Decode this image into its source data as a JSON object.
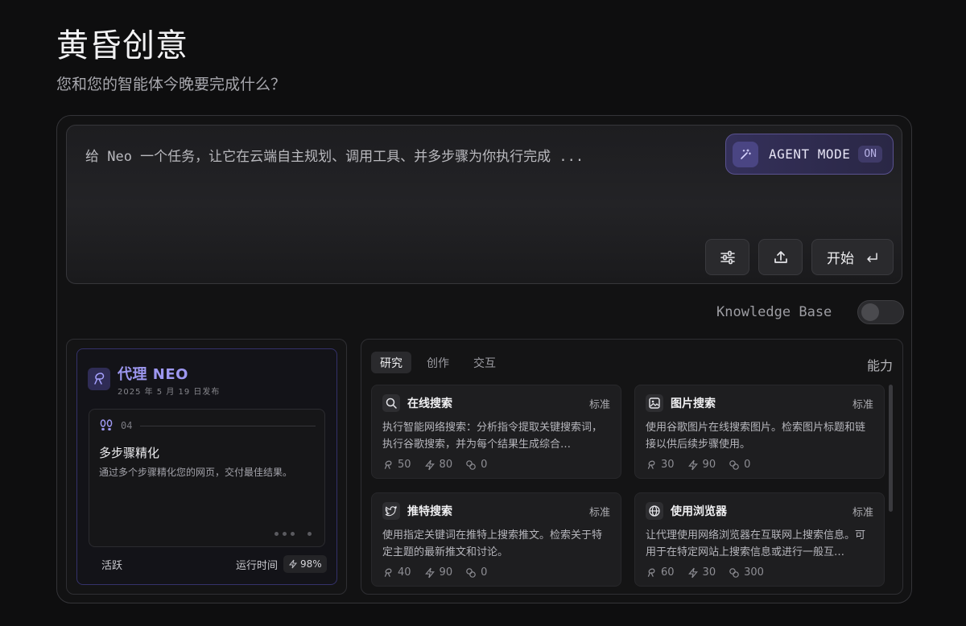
{
  "header": {
    "title": "黄昏创意",
    "subtitle": "您和您的智能体今晚要完成什么？"
  },
  "prompt": {
    "placeholder": "给 Neo 一个任务，让它在云端自主规划、调用工具、并多步骤为你执行完成 ...",
    "agent_mode_label": "AGENT MODE",
    "agent_mode_status": "ON",
    "start_label": "开始"
  },
  "knowledge_base": {
    "label": "Knowledge Base",
    "enabled": false
  },
  "agent": {
    "name": "代理 NEO",
    "published": "2025 年 5 月 19 日发布",
    "step": {
      "number": "04",
      "title": "多步骤精化",
      "description": "通过多个步骤精化您的网页，交付最佳结果。"
    },
    "status_label": "活跃",
    "runtime_label": "运行时间",
    "runtime_value": "98%"
  },
  "capabilities": {
    "tabs": [
      "研究",
      "创作",
      "交互"
    ],
    "active_tab": 0,
    "title": "能力",
    "tools": [
      {
        "name": "在线搜索",
        "tier": "标准",
        "icon": "search-icon",
        "description": "执行智能网络搜索：分析指令提取关键搜索词，执行谷歌搜索，并为每个结果生成综合…",
        "stats": [
          "50",
          "80",
          "0"
        ]
      },
      {
        "name": "图片搜索",
        "tier": "标准",
        "icon": "image-icon",
        "description": "使用谷歌图片在线搜索图片。检索图片标题和链接以供后续步骤使用。",
        "stats": [
          "30",
          "90",
          "0"
        ]
      },
      {
        "name": "推特搜索",
        "tier": "标准",
        "icon": "twitter-icon",
        "description": "使用指定关键词在推特上搜索推文。检索关于特定主题的最新推文和讨论。",
        "stats": [
          "40",
          "90",
          "0"
        ]
      },
      {
        "name": "使用浏览器",
        "tier": "标准",
        "icon": "globe-icon",
        "description": "让代理使用网络浏览器在互联网上搜索信息。可用于在特定网站上搜索信息或进行一般互…",
        "stats": [
          "60",
          "30",
          "300"
        ]
      }
    ]
  },
  "colors": {
    "accent": "#9d97f0",
    "background": "#0e0e0f"
  }
}
